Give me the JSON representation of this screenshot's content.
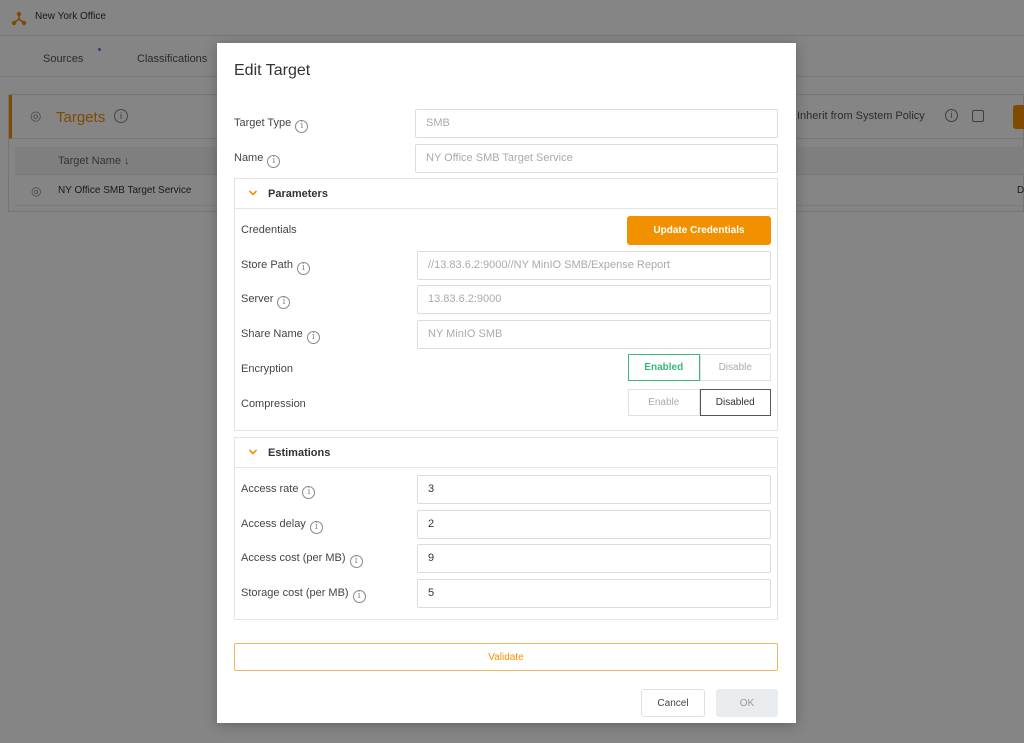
{
  "app": {
    "office_name": "New York Office",
    "accent_color": "#f29100"
  },
  "nav": {
    "tabs": [
      {
        "label": "Sources"
      },
      {
        "label": "Classifications"
      }
    ]
  },
  "targets": {
    "title": "Targets",
    "inherit_label": "Inherit from System Policy",
    "columns": [
      {
        "label": "Target Name ↓"
      }
    ],
    "rows": [
      {
        "name": "NY Office SMB Target Service",
        "trailing": "De"
      }
    ]
  },
  "modal": {
    "title": "Edit Target",
    "target_type": {
      "label": "Target Type",
      "value": "SMB"
    },
    "name": {
      "label": "Name",
      "value": "NY Office SMB Target Service"
    },
    "parameters": {
      "title": "Parameters",
      "credentials_label": "Credentials",
      "update_credentials_label": "Update Credentials",
      "store_path": {
        "label": "Store Path",
        "value": "//13.83.6.2:9000//NY MinIO SMB/Expense Report"
      },
      "server": {
        "label": "Server",
        "value": "13.83.6.2:9000"
      },
      "share_name": {
        "label": "Share Name",
        "value": "NY MinIO SMB"
      },
      "encryption": {
        "label": "Encryption",
        "options": [
          "Enabled",
          "Disable"
        ],
        "selected": "Enabled"
      },
      "compression": {
        "label": "Compression",
        "options": [
          "Enable",
          "Disabled"
        ],
        "selected": "Disabled"
      }
    },
    "estimations": {
      "title": "Estimations",
      "access_rate": {
        "label": "Access rate",
        "value": "3"
      },
      "access_delay": {
        "label": "Access delay",
        "value": "2"
      },
      "access_cost": {
        "label": "Access cost (per MB)",
        "value": "9"
      },
      "storage_cost": {
        "label": "Storage cost (per MB)",
        "value": "5"
      }
    },
    "validate_label": "Validate",
    "cancel_label": "Cancel",
    "ok_label": "OK"
  }
}
